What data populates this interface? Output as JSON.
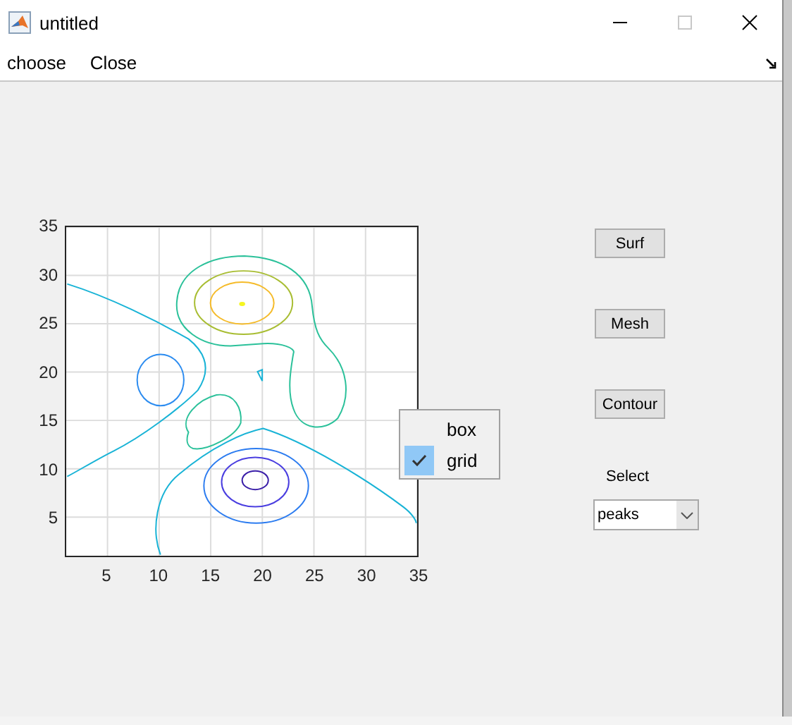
{
  "window": {
    "title": "untitled"
  },
  "menu": [
    {
      "label": "choose"
    },
    {
      "label": "Close"
    }
  ],
  "axes": {
    "xticks": [
      "5",
      "10",
      "15",
      "20",
      "25",
      "30",
      "35"
    ],
    "yticks": [
      "35",
      "30",
      "25",
      "20",
      "15",
      "10",
      "5"
    ]
  },
  "context_menu": [
    {
      "label": "box",
      "checked": false
    },
    {
      "label": "grid",
      "checked": true
    }
  ],
  "buttons": [
    "Surf",
    "Mesh",
    "Contour"
  ],
  "select": {
    "label": "Select",
    "value": "peaks"
  }
}
